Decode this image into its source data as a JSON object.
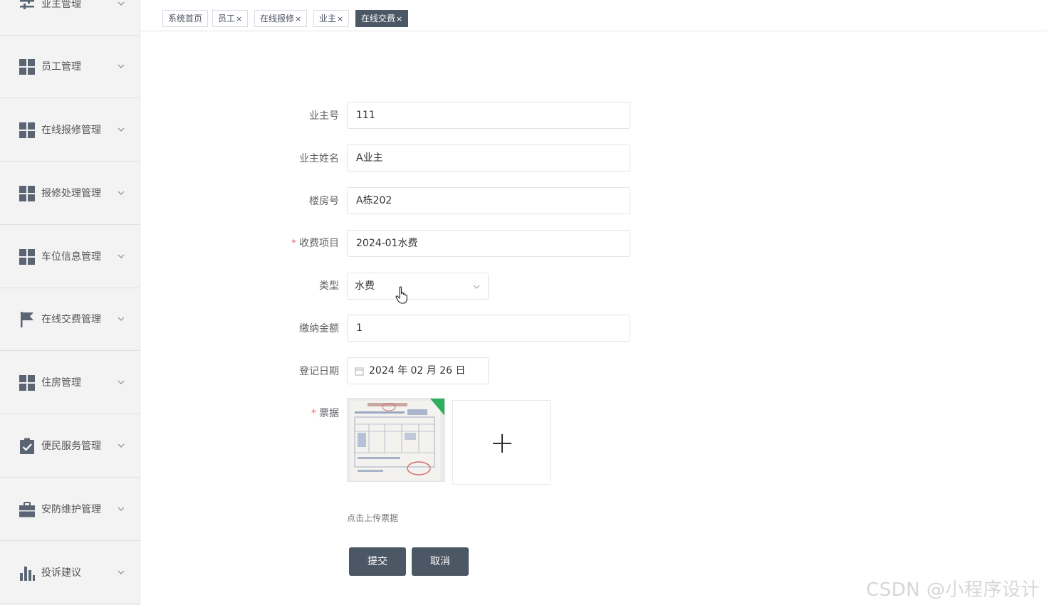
{
  "sidebar": {
    "items": [
      {
        "label": "业主管理",
        "icon": "sliders-icon"
      },
      {
        "label": "员工管理",
        "icon": "grid-icon"
      },
      {
        "label": "在线报修管理",
        "icon": "grid-icon"
      },
      {
        "label": "报修处理管理",
        "icon": "grid-icon"
      },
      {
        "label": "车位信息管理",
        "icon": "grid-icon"
      },
      {
        "label": "在线交费管理",
        "icon": "flag-icon"
      },
      {
        "label": "住房管理",
        "icon": "grid-icon"
      },
      {
        "label": "便民服务管理",
        "icon": "clipboard-check-icon"
      },
      {
        "label": "安防维护管理",
        "icon": "briefcase-icon"
      },
      {
        "label": "投诉建议",
        "icon": "bar-chart-icon"
      }
    ]
  },
  "tabs": [
    {
      "label": "系统首页",
      "closable": false,
      "active": false
    },
    {
      "label": "员工",
      "closable": true,
      "active": false
    },
    {
      "label": "在线报修",
      "closable": true,
      "active": false
    },
    {
      "label": "业主",
      "closable": true,
      "active": false
    },
    {
      "label": "在线交费",
      "closable": true,
      "active": true
    }
  ],
  "tab_close_glyph": "×",
  "form": {
    "owner_no": {
      "label": "业主号",
      "value": "111"
    },
    "owner_name": {
      "label": "业主姓名",
      "value": "A业主"
    },
    "building_no": {
      "label": "楼房号",
      "value": "A栋202"
    },
    "fee_item": {
      "label": "收费项目",
      "value": "2024-01水费",
      "required": true
    },
    "fee_type": {
      "label": "类型",
      "value": "水费"
    },
    "amount": {
      "label": "缴纳金额",
      "value": "1"
    },
    "reg_date": {
      "label": "登记日期",
      "value": "2024 年 02 月 26 日"
    },
    "receipt": {
      "label": "票据",
      "required": true,
      "hint": "点击上传票据"
    },
    "required_mark": "*"
  },
  "buttons": {
    "submit": "提交",
    "cancel": "取消"
  },
  "watermark": "CSDN @小程序设计",
  "colors": {
    "accent": "#4b5764",
    "required": "#f56c6c",
    "sidebar_bg": "#f3f3f3"
  }
}
